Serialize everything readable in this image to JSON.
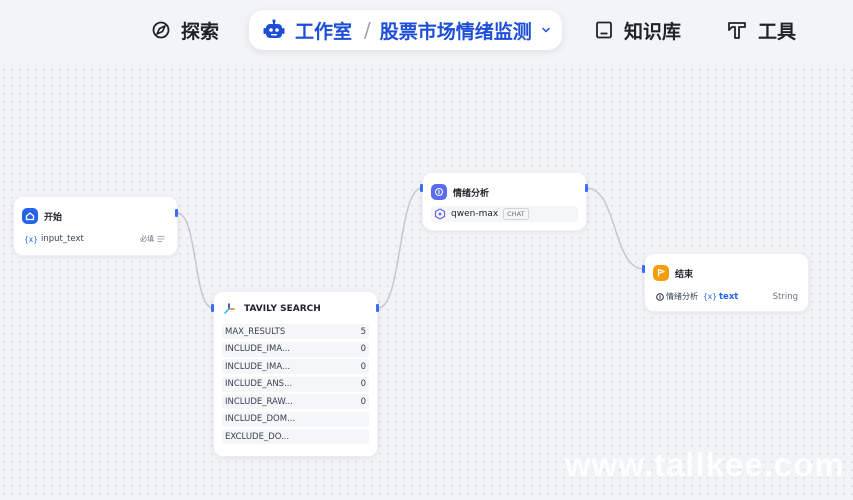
{
  "nav": {
    "explore": "探索",
    "studio": "工作室",
    "separator": "/",
    "project": "股票市场情绪监测",
    "knowledge": "知识库",
    "tools": "工具"
  },
  "nodes": {
    "start": {
      "title": "开始",
      "var_icon": "{x}",
      "var": "input_text",
      "required": "必填"
    },
    "search": {
      "title": "TAVILY SEARCH",
      "params": [
        {
          "name": "MAX_RESULTS",
          "value": "5"
        },
        {
          "name": "INCLUDE_IMA...",
          "value": "0"
        },
        {
          "name": "INCLUDE_IMA...",
          "value": "0"
        },
        {
          "name": "INCLUDE_ANS...",
          "value": "0"
        },
        {
          "name": "INCLUDE_RAW...",
          "value": "0"
        },
        {
          "name": "INCLUDE_DOM...",
          "value": ""
        },
        {
          "name": "EXCLUDE_DO...",
          "value": ""
        }
      ]
    },
    "llm": {
      "title": "情绪分析",
      "model": "qwen-max",
      "mode": "CHAT"
    },
    "end": {
      "title": "结束",
      "source": "情绪分析",
      "var_icon": "{x}",
      "var": "text",
      "type": "String"
    }
  },
  "watermark": "www.tallkee.com",
  "colors": {
    "accent": "#1d4ed8",
    "start_icon": "#2563eb",
    "llm_icon": "#5b6cf0",
    "end_icon": "#f59e0b",
    "edge": "#c3c8d2"
  }
}
